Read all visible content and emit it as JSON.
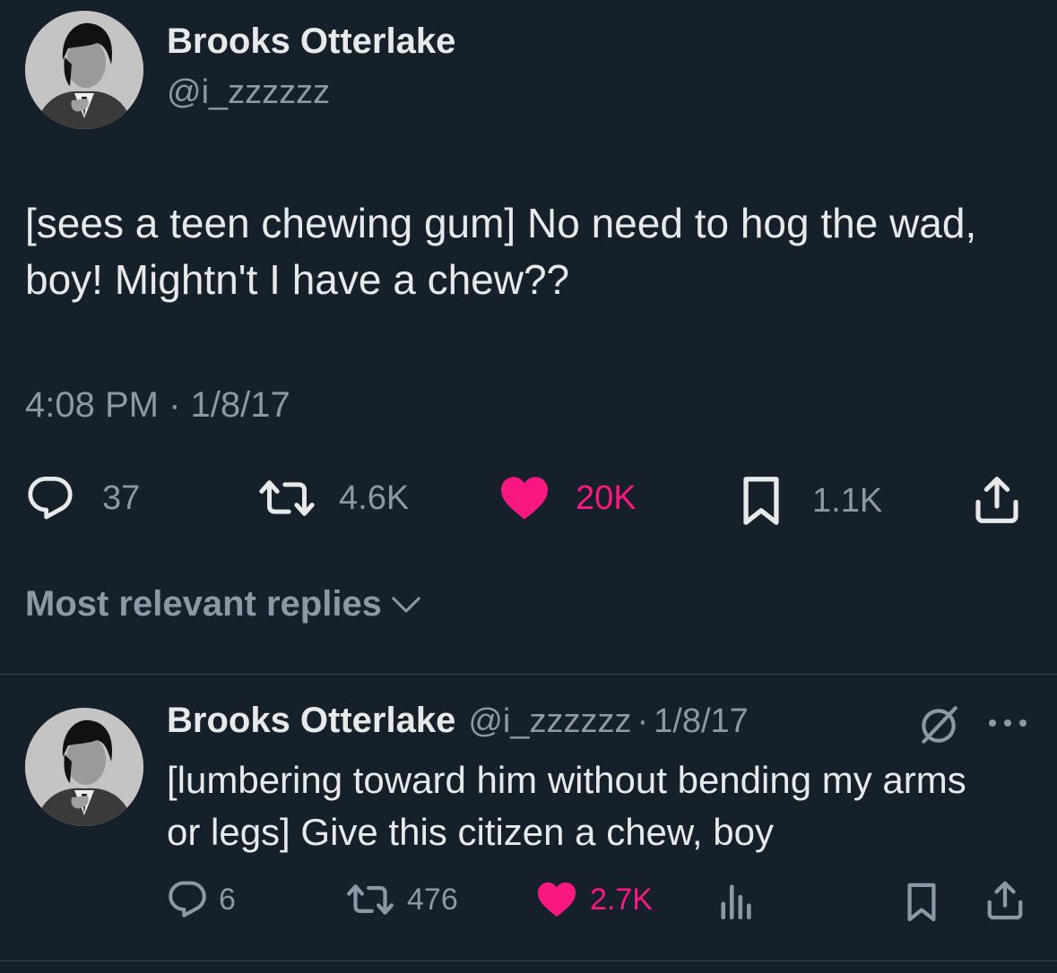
{
  "tweet": {
    "author_name": "Brooks Otterlake",
    "author_handle": "@i_zzzzzz",
    "text": "[sees a teen chewing gum] No need to hog the wad, boy! Mightn't I have a chew??",
    "timestamp": "4:08 PM · 1/8/17",
    "stats": {
      "replies": "37",
      "retweets": "4.6K",
      "likes": "20K",
      "bookmarks": "1.1K"
    }
  },
  "replies_sort": {
    "label": "Most relevant replies"
  },
  "reply": {
    "author_name": "Brooks Otterlake",
    "author_handle": "@i_zzzzzz",
    "separator": "·",
    "date": "1/8/17",
    "text": "[lumbering toward him without bending my arms or legs] Give this citizen a chew, boy",
    "stats": {
      "replies": "6",
      "retweets": "476",
      "likes": "2.7K"
    }
  },
  "colors": {
    "background": "#15202b",
    "text": "#e7e9ea",
    "muted": "#8b98a5",
    "like": "#f91880",
    "divider": "#38444d"
  },
  "icons": [
    "reply-icon",
    "retweet-icon",
    "heart-icon",
    "bookmark-icon",
    "share-icon",
    "chevron-down-icon",
    "analytics-icon",
    "grok-icon",
    "more-icon"
  ]
}
